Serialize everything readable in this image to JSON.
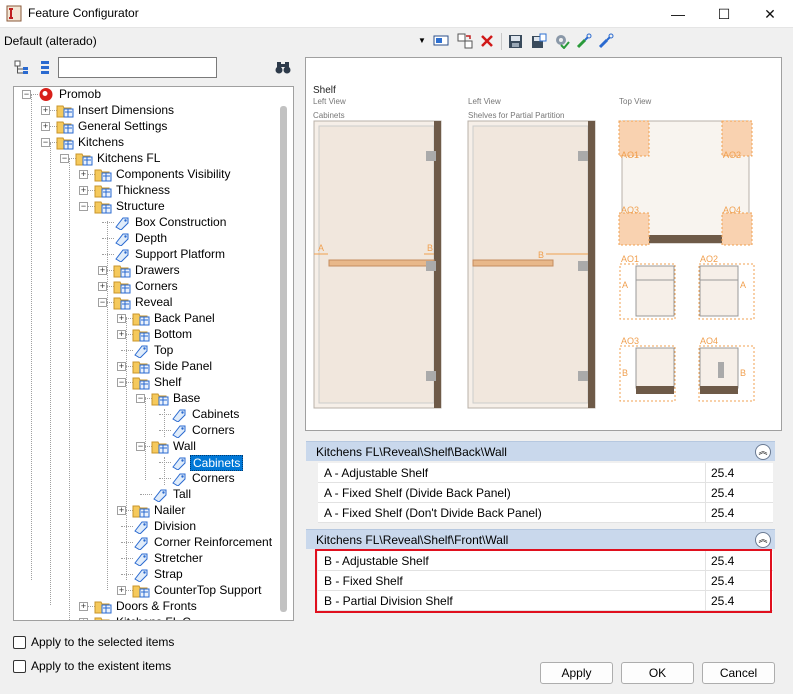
{
  "window": {
    "title": "Feature Configurator",
    "minimize_glyph": "—",
    "maximize_glyph": "☐",
    "close_glyph": "✕"
  },
  "toolbar": {
    "preset": "Default (alterado)",
    "icons": [
      "screen-select-icon",
      "copy-arrow-icon",
      "delete-x-icon",
      "save-icon",
      "save-as-icon",
      "settings-check-icon",
      "import-icon",
      "export-icon"
    ]
  },
  "tree": {
    "search_placeholder": "",
    "nodes": {
      "promob": "Promob",
      "insert_dimensions": "Insert Dimensions",
      "general_settings": "General Settings",
      "kitchens": "Kitchens",
      "kitchens_fl": "Kitchens FL",
      "components_visibility": "Components Visibility",
      "thickness": "Thickness",
      "structure": "Structure",
      "box_construction": "Box Construction",
      "depth": "Depth",
      "support_platform": "Support Platform",
      "drawers": "Drawers",
      "corners": "Corners",
      "reveal": "Reveal",
      "back_panel": "Back Panel",
      "bottom": "Bottom",
      "top": "Top",
      "side_panel": "Side Panel",
      "shelf": "Shelf",
      "base": "Base",
      "base_cabinets": "Cabinets",
      "base_corners": "Corners",
      "wall": "Wall",
      "wall_cabinets": "Cabinets",
      "wall_corners": "Corners",
      "tall": "Tall",
      "nailer": "Nailer",
      "division": "Division",
      "corner_reinforcement": "Corner Reinforcement",
      "stretcher": "Stretcher",
      "strap": "Strap",
      "countertop_support": "CounterTop Support",
      "doors_fronts": "Doors & Fronts",
      "kitchens_fl_c": "Kitchens FL C..."
    }
  },
  "options": {
    "apply_selected": "Apply to the selected items",
    "apply_existent": "Apply to the existent items"
  },
  "preview": {
    "heading": "Shelf",
    "left_view_1": "Left View",
    "cabinets": "Cabinets",
    "left_view_2": "Left View",
    "shelves_partial": "Shelves for Partial Partition",
    "top_view": "Top View",
    "mark_a": "A",
    "mark_b": "B",
    "mark_b2": "B",
    "ao1": "AO1",
    "ao2": "AO2",
    "ao3": "AO3",
    "ao4": "AO4",
    "d_ao1": "AO1",
    "d_ao2": "AO2",
    "d_ao3": "AO3",
    "d_ao4": "AO4",
    "d_a1": "A",
    "d_a2": "A",
    "d_b1": "B",
    "d_b2": "B"
  },
  "groups": [
    {
      "path": "Kitchens FL\\Reveal\\Shelf\\Back\\Wall",
      "rows": [
        {
          "name": "A - Adjustable Shelf",
          "value": "25.4"
        },
        {
          "name": "A - Fixed Shelf (Divide Back Panel)",
          "value": "25.4"
        },
        {
          "name": "A - Fixed Shelf (Don't Divide Back Panel)",
          "value": "25.4"
        }
      ]
    },
    {
      "path": "Kitchens FL\\Reveal\\Shelf\\Front\\Wall",
      "rows": [
        {
          "name": "B - Adjustable Shelf",
          "value": "25.4"
        },
        {
          "name": "B - Fixed Shelf",
          "value": "25.4"
        },
        {
          "name": "B - Partial Division Shelf",
          "value": "25.4"
        }
      ]
    }
  ],
  "buttons": {
    "apply": "Apply",
    "ok": "OK",
    "cancel": "Cancel"
  },
  "colors": {
    "selection": "#0078d7",
    "highlight": "#e0101e",
    "group_header": "#c9d8ec",
    "orange_mark": "#f0a050",
    "shelf_wood": "#e8b88a"
  }
}
